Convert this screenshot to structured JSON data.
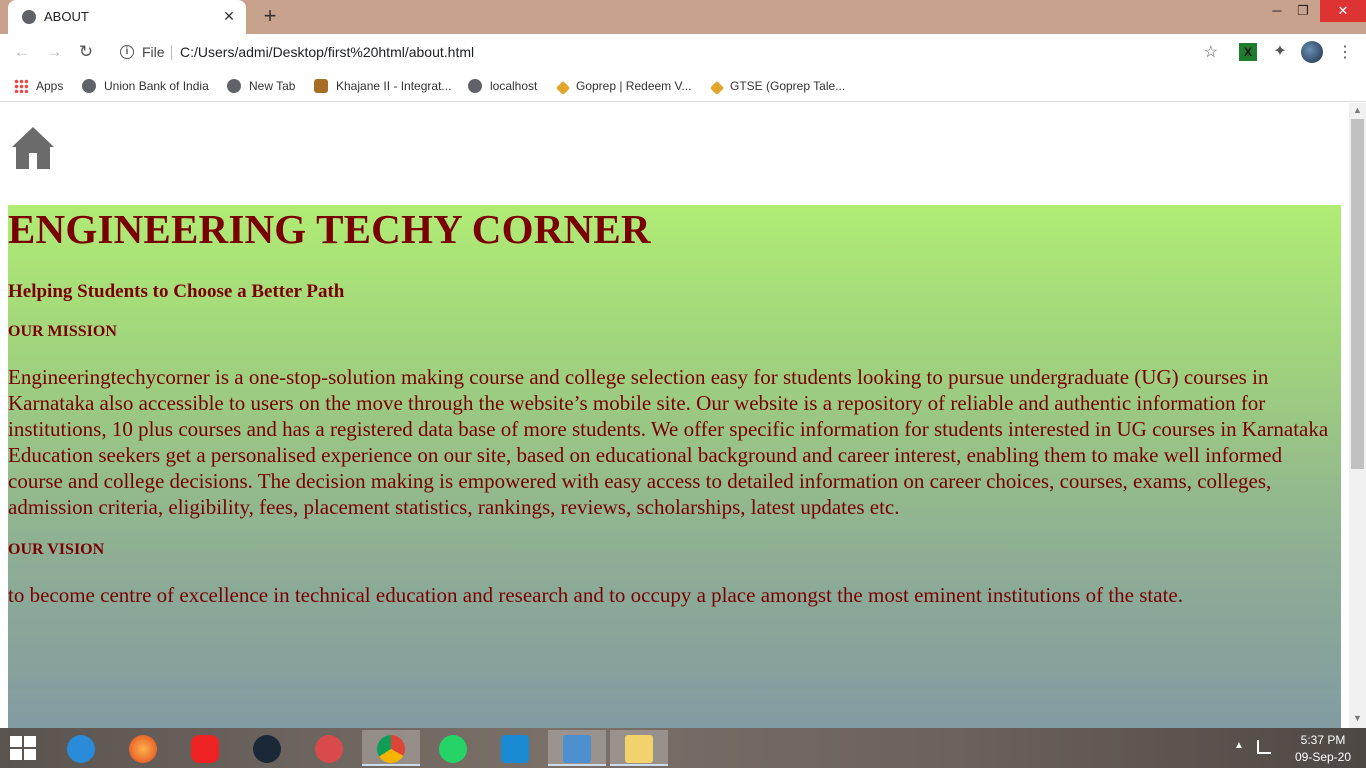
{
  "browser": {
    "tab": {
      "title": "ABOUT",
      "close_symbol": "✕"
    },
    "new_tab_symbol": "+",
    "window_buttons": {
      "minimize": "─",
      "restore": "❐",
      "close": "✕"
    },
    "nav": {
      "back": "←",
      "forward": "→",
      "reload": "↻"
    },
    "address": {
      "scheme_label": "File",
      "url": "C:/Users/admi/Desktop/first%20html/about.html",
      "star": "☆"
    },
    "extensions": {
      "green_ext": "X",
      "puzzle": "✦"
    },
    "menu": "⋮"
  },
  "bookmarks": [
    {
      "label": "Apps",
      "icon": "apps-grid-icon"
    },
    {
      "label": "Union Bank of India",
      "icon": "globe-icon"
    },
    {
      "label": "New Tab",
      "icon": "globe-icon"
    },
    {
      "label": "Khajane II - Integrat...",
      "icon": "emblem-icon"
    },
    {
      "label": "localhost",
      "icon": "globe-icon"
    },
    {
      "label": "Goprep | Redeem V...",
      "icon": "goprep-icon"
    },
    {
      "label": "GTSE (Goprep Tale...",
      "icon": "goprep-icon"
    }
  ],
  "page": {
    "home_icon": "home-icon",
    "title": "ENGINEERING TECHY CORNER",
    "tagline": "Helping Students to Choose a Better Path",
    "mission_heading": "OUR MISSION",
    "mission_text": "Engineeringtechycorner is a one-stop-solution making course and college selection easy for students looking to pursue undergraduate (UG) courses in Karnataka also accessible to users on the move through the website’s mobile site. Our website is a repository of reliable and authentic information for institutions, 10 plus courses and has a registered data base of more students. We offer specific information for students interested in UG courses in Karnataka Education seekers get a personalised experience on our site, based on educational background and career interest, enabling them to make well informed course and college decisions. The decision making is empowered with easy access to detailed information on career choices, courses, exams, colleges, admission criteria, eligibility, fees, placement statistics, rankings, reviews, scholarships, latest updates etc.",
    "vision_heading": "OUR VISION",
    "vision_text": "to become centre of excellence in technical education and research and to occupy a place amongst the most eminent institutions of the state.",
    "colors": {
      "text": "#7a0000",
      "gradient_top": "#b0ec74",
      "gradient_bottom": "#809aa3"
    }
  },
  "taskbar": {
    "apps": [
      "internet-explorer",
      "firefox",
      "app-red",
      "steam",
      "snipping-tool",
      "chrome",
      "whatsapp",
      "vscode",
      "control-panel",
      "file-explorer"
    ],
    "active_app": "chrome",
    "clock": {
      "time": "5:37 PM",
      "date": "09-Sep-20"
    }
  }
}
